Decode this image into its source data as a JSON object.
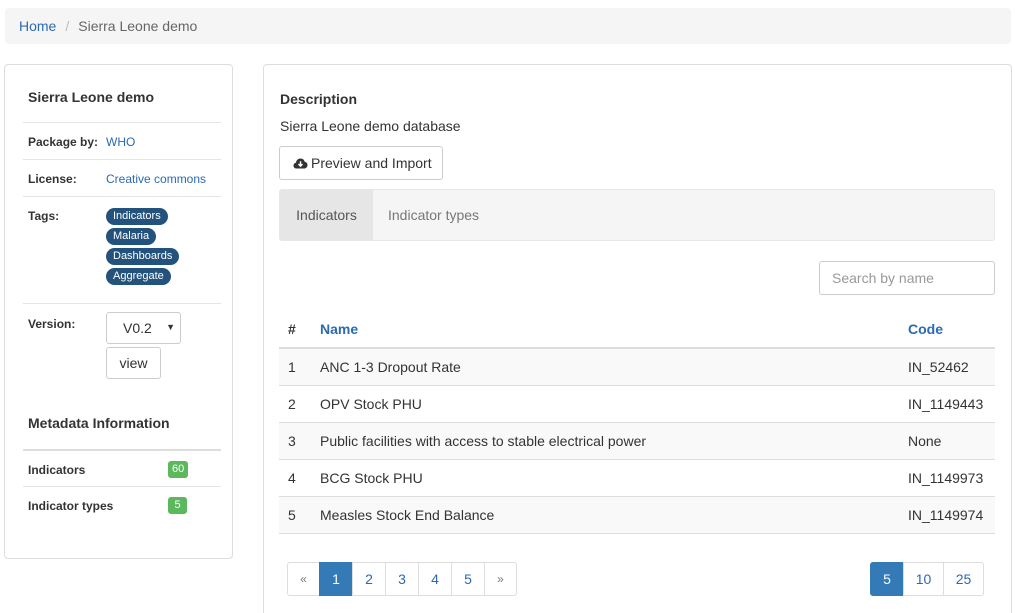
{
  "breadcrumb": {
    "home": "Home",
    "separator": "/",
    "current": "Sierra Leone demo"
  },
  "sidebar": {
    "title": "Sierra Leone demo",
    "package_by_label": "Package by:",
    "package_by_value": "WHO",
    "license_label": "License:",
    "license_value": "Creative commons",
    "tags_label": "Tags:",
    "tags": [
      "Indicators",
      "Malaria",
      "Dashboards",
      "Aggregate"
    ],
    "version_label": "Version:",
    "version_selected": "V0.2",
    "view_button": "view",
    "metadata_title": "Metadata Information",
    "metadata": [
      {
        "label": "Indicators",
        "count": "60"
      },
      {
        "label": "Indicator types",
        "count": "5"
      }
    ]
  },
  "main": {
    "description_title": "Description",
    "description_text": "Sierra Leone demo database",
    "import_button": "Preview and Import",
    "tabs": [
      "Indicators",
      "Indicator types"
    ],
    "search_placeholder": "Search by name",
    "table": {
      "headers": [
        "#",
        "Name",
        "Code"
      ],
      "rows": [
        {
          "num": "1",
          "name": "ANC 1-3 Dropout Rate",
          "code": "IN_52462"
        },
        {
          "num": "2",
          "name": "OPV Stock PHU",
          "code": "IN_1149443"
        },
        {
          "num": "3",
          "name": "Public facilities with access to stable electrical power",
          "code": "None"
        },
        {
          "num": "4",
          "name": "BCG Stock PHU",
          "code": "IN_1149973"
        },
        {
          "num": "5",
          "name": "Measles Stock End Balance",
          "code": "IN_1149974"
        }
      ]
    },
    "pagination": {
      "prev": "«",
      "pages": [
        "1",
        "2",
        "3",
        "4",
        "5"
      ],
      "next": "»",
      "active_page": "1"
    },
    "page_size": {
      "options": [
        "5",
        "10",
        "25"
      ],
      "active": "5"
    }
  },
  "colors": {
    "link": "#2a6ab3",
    "tag_bg": "#23527c",
    "badge_green": "#5cb85c",
    "active_blue": "#337ab7"
  }
}
